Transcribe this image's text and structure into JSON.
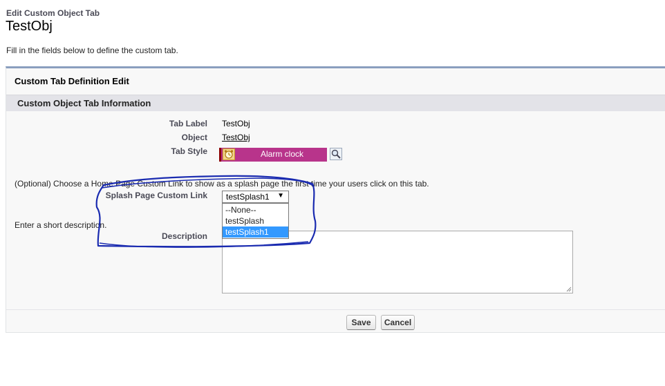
{
  "header": {
    "eyebrow": "Edit Custom Object Tab",
    "title": "TestObj",
    "intro": "Fill in the fields below to define the custom tab."
  },
  "panel": {
    "title": "Custom Tab Definition Edit",
    "section_title": "Custom Object Tab Information"
  },
  "fields": {
    "tab_label": {
      "label": "Tab Label",
      "value": "TestObj"
    },
    "object": {
      "label": "Object",
      "value": "TestObj"
    },
    "tab_style": {
      "label": "Tab Style",
      "value": "Alarm clock",
      "color": "#b8348b",
      "icon": "alarm-clock-icon"
    }
  },
  "splash": {
    "instruction": "(Optional) Choose a Home Page Custom Link to show as a splash page the first time your users click on this tab.",
    "label": "Splash Page Custom Link",
    "selected": "testSplash1",
    "options": [
      "--None--",
      "testSplash",
      "testSplash1"
    ]
  },
  "description": {
    "instruction": "Enter a short description.",
    "label": "Description",
    "value": ""
  },
  "buttons": {
    "save": "Save",
    "cancel": "Cancel"
  },
  "colors": {
    "annotation": "#1a2bb0",
    "selected_option": "#3399ff",
    "panel_accent": "#8a9ebe"
  }
}
